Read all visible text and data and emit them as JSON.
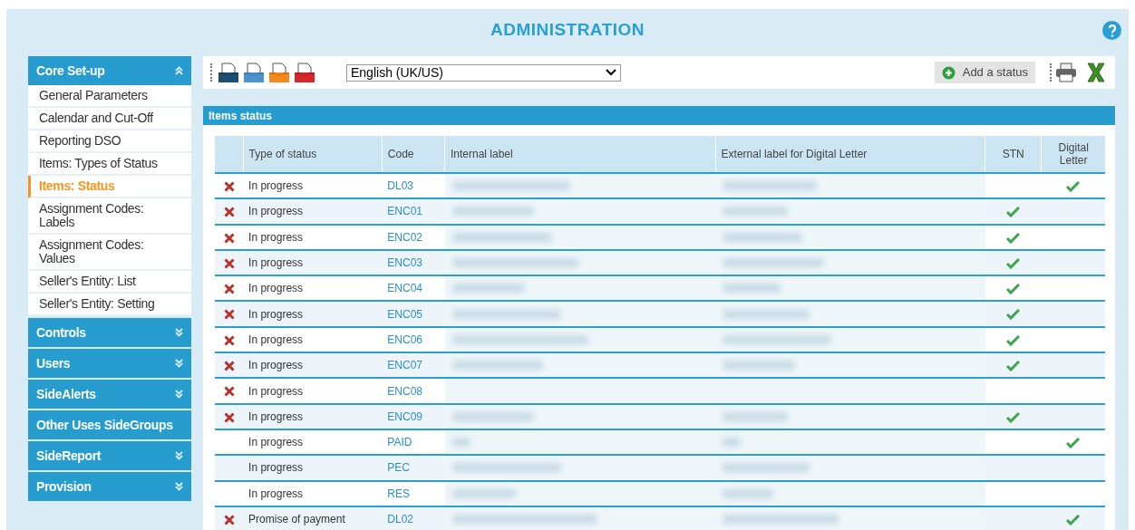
{
  "title": "ADMINISTRATION",
  "sidebar": [
    {
      "label": "Core Set-up",
      "expanded": true,
      "collapsible": true,
      "items": [
        {
          "label": "General Parameters",
          "selected": false
        },
        {
          "label": "Calendar and Cut-Off",
          "selected": false
        },
        {
          "label": "Reporting DSO",
          "selected": false
        },
        {
          "label": "Items: Types of Status",
          "selected": false
        },
        {
          "label": "Items: Status",
          "selected": true
        },
        {
          "label": "Assignment Codes: Labels",
          "selected": false
        },
        {
          "label": "Assignment Codes: Values",
          "selected": false
        },
        {
          "label": "Seller's Entity: List",
          "selected": false
        },
        {
          "label": "Seller's Entity: Setting",
          "selected": false
        }
      ]
    },
    {
      "label": "Controls",
      "expanded": false,
      "collapsible": true
    },
    {
      "label": "Users",
      "expanded": false,
      "collapsible": true
    },
    {
      "label": "SideAlerts",
      "expanded": false,
      "collapsible": true
    },
    {
      "label": "Other Uses SideGroups",
      "collapsible": false
    },
    {
      "label": "SideReport",
      "expanded": false,
      "collapsible": true
    },
    {
      "label": "Provision",
      "expanded": false,
      "collapsible": true
    }
  ],
  "toolbar": {
    "language": "English (UK/US)",
    "add_button": "Add a status"
  },
  "section_title": "Items status",
  "table": {
    "columns": [
      "Type of status",
      "Code",
      "Internal label",
      "External label for Digital Letter",
      "STN",
      "Digital Letter"
    ],
    "rows": [
      {
        "deletable": true,
        "type": "In progress",
        "code": "DL03",
        "stn": false,
        "digital": true
      },
      {
        "deletable": true,
        "type": "In progress",
        "code": "ENC01",
        "stn": true,
        "digital": false
      },
      {
        "deletable": true,
        "type": "In progress",
        "code": "ENC02",
        "stn": true,
        "digital": false
      },
      {
        "deletable": true,
        "type": "In progress",
        "code": "ENC03",
        "stn": true,
        "digital": false
      },
      {
        "deletable": true,
        "type": "In progress",
        "code": "ENC04",
        "stn": true,
        "digital": false
      },
      {
        "deletable": true,
        "type": "In progress",
        "code": "ENC05",
        "stn": true,
        "digital": false
      },
      {
        "deletable": true,
        "type": "In progress",
        "code": "ENC06",
        "stn": true,
        "digital": false
      },
      {
        "deletable": true,
        "type": "In progress",
        "code": "ENC07",
        "stn": true,
        "digital": false
      },
      {
        "deletable": true,
        "type": "In progress",
        "code": "ENC08",
        "stn": false,
        "digital": false
      },
      {
        "deletable": true,
        "type": "In progress",
        "code": "ENC09",
        "stn": true,
        "digital": false
      },
      {
        "deletable": false,
        "type": "In progress",
        "code": "PAID",
        "stn": false,
        "digital": true
      },
      {
        "deletable": false,
        "type": "In progress",
        "code": "PEC",
        "stn": false,
        "digital": false
      },
      {
        "deletable": false,
        "type": "In progress",
        "code": "RES",
        "stn": false,
        "digital": false
      },
      {
        "deletable": true,
        "type": "Promise of payment",
        "code": "DL02",
        "stn": false,
        "digital": true
      }
    ]
  }
}
